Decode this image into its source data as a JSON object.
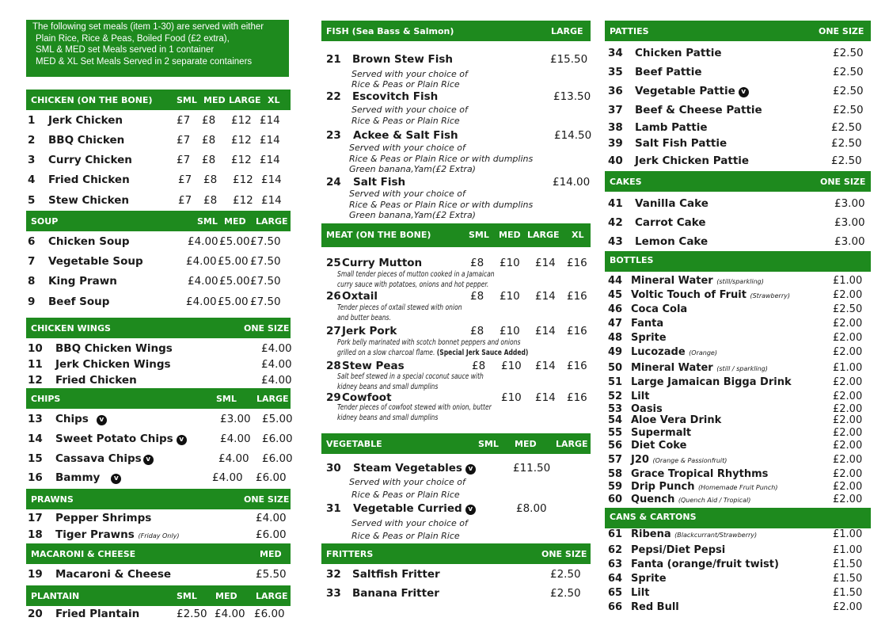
{
  "info_lines": [
    "The following set meals (item 1-30) are served with either",
    "Plain Rice, Rice & Peas, Boiled Food (£2 extra),",
    "SML & MED set Meals served in 1 container",
    "MED & XL Set Meals Served in 2 separate containers"
  ],
  "veg_badge": "v",
  "colors": {
    "header_green": "#1e8a1e"
  },
  "chicken": {
    "title": "CHICKEN (ON THE BONE)",
    "sizes": [
      "SML",
      "MED",
      "LARGE",
      "XL"
    ],
    "items": [
      {
        "num": "1",
        "name": "Jerk Chicken",
        "prices": [
          "£7",
          "£8",
          "£12",
          "£14"
        ]
      },
      {
        "num": "2",
        "name": "BBQ Chicken",
        "prices": [
          "£7",
          "£8",
          "£12",
          "£14"
        ]
      },
      {
        "num": "3",
        "name": "Curry Chicken",
        "prices": [
          "£7",
          "£8",
          "£12",
          "£14"
        ]
      },
      {
        "num": "4",
        "name": "Fried Chicken",
        "prices": [
          "£7",
          "£8",
          "£12",
          "£14"
        ]
      },
      {
        "num": "5",
        "name": "Stew Chicken",
        "prices": [
          "£7",
          "£8",
          "£12",
          "£14"
        ]
      }
    ]
  },
  "soup": {
    "title": "SOUP",
    "sizes": [
      "SML",
      "MED",
      "LARGE"
    ],
    "items": [
      {
        "num": "6",
        "name": "Chicken Soup",
        "prices": [
          "£4.00",
          "£5.00",
          "£7.50"
        ]
      },
      {
        "num": "7",
        "name": "Vegetable Soup",
        "prices": [
          "£4.00",
          "£5.00",
          "£7.50"
        ]
      },
      {
        "num": "8",
        "name": "King Prawn",
        "prices": [
          "£4.00",
          "£5.00",
          "£7.50"
        ]
      },
      {
        "num": "9",
        "name": "Beef Soup",
        "prices": [
          "£4.00",
          "£5.00",
          "£7.50"
        ]
      }
    ]
  },
  "wings": {
    "title": "CHICKEN WINGS",
    "size": "ONE SIZE",
    "items": [
      {
        "num": "10",
        "name": "BBQ Chicken Wings",
        "price": "£4.00"
      },
      {
        "num": "11",
        "name": "Jerk Chicken Wings",
        "price": "£4.00"
      },
      {
        "num": "12",
        "name": "Fried Chicken",
        "price": "£4.00"
      }
    ]
  },
  "chips": {
    "title": "CHIPS",
    "sizes": [
      "SML",
      "LARGE"
    ],
    "items": [
      {
        "num": "13",
        "name": "Chips",
        "prices": [
          "£3.00",
          "£5.00"
        ]
      },
      {
        "num": "14",
        "name": "Sweet Potato Chips",
        "prices": [
          "£4.00",
          "£6.00"
        ]
      },
      {
        "num": "15",
        "name": "Cassava Chips",
        "prices": [
          "£4.00",
          "£6.00"
        ]
      },
      {
        "num": "16",
        "name": "Bammy",
        "prices": [
          "£4.00",
          "£6.00"
        ]
      }
    ]
  },
  "prawns": {
    "title": "PRAWNS",
    "size": "ONE SIZE",
    "items": [
      {
        "num": "17",
        "name": "Pepper Shrimps",
        "price": "£4.00",
        "note": ""
      },
      {
        "num": "18",
        "name": "Tiger Prawns",
        "price": "£6.00",
        "note": "(Friday Only)"
      }
    ]
  },
  "mac": {
    "title": "MACARONI & CHEESE",
    "size": "MED",
    "items": [
      {
        "num": "19",
        "name": "Macaroni & Cheese",
        "price": "£5.50"
      }
    ]
  },
  "plantain": {
    "title": "PLANTAIN",
    "sizes": [
      "SML",
      "MED",
      "LARGE"
    ],
    "items": [
      {
        "num": "20",
        "name": "Fried Plantain",
        "prices": [
          "£2.50",
          "£4.00",
          "£6.00"
        ]
      }
    ]
  },
  "fish": {
    "title": "FISH (Sea Bass & Salmon)",
    "size": "LARGE",
    "items": [
      {
        "num": "21",
        "name": "Brown Stew Fish",
        "price": "£15.50",
        "notes": [
          "Served with your choice of",
          "Rice & Peas or Plain Rice"
        ]
      },
      {
        "num": "22",
        "name": "Escovitch Fish",
        "price": "£13.50",
        "notes": [
          "Served with your choice of",
          "Rice & Peas or Plain Rice"
        ]
      },
      {
        "num": "23",
        "name": "Ackee & Salt Fish",
        "price": "£14.50",
        "notes": [
          "Served with your choice of",
          "Rice & Peas or Plain Rice or with dumplins",
          "Green banana,Yam(£2 Extra)"
        ]
      },
      {
        "num": "24",
        "name": "Salt Fish",
        "price": "£14.00",
        "notes": [
          "Served with your choice of",
          "Rice & Peas or Plain Rice or with dumplins",
          "Green banana,Yam(£2 Extra)"
        ]
      }
    ]
  },
  "meat": {
    "title": "MEAT (ON THE BONE)",
    "sizes": [
      "SML",
      "MED",
      "LARGE",
      "XL"
    ],
    "items": [
      {
        "num": "25",
        "name": "Curry Mutton",
        "prices": [
          "£8",
          "£10",
          "£14",
          "£16"
        ],
        "notes": [
          "Small tender pieces of mutton cooked in a  Jamaican",
          "curry sauce with potatoes, onions and hot pepper."
        ],
        "bold_note": ""
      },
      {
        "num": "26",
        "name": "Oxtail",
        "prices": [
          "£8",
          "£10",
          "£14",
          "£16"
        ],
        "notes": [
          "Tender pieces of oxtail stewed with onion",
          "and butter beans."
        ],
        "bold_note": ""
      },
      {
        "num": "27",
        "name": "Jerk Pork",
        "prices": [
          "£8",
          "£10",
          "£14",
          "£16"
        ],
        "notes": [
          "Pork belly marinated with scotch bonnet peppers and onions",
          "grilled on a slow charcoal flame."
        ],
        "bold_note": "(Special Jerk Sauce Added)"
      },
      {
        "num": "28",
        "name": "Stew Peas",
        "prices": [
          "£8",
          "£10",
          "£14",
          "£16"
        ],
        "notes": [
          "Salt beef stewed in a special coconut sauce with",
          "kidney beans and small dumplins"
        ],
        "bold_note": ""
      },
      {
        "num": "29",
        "name": "Cowfoot",
        "prices": [
          "",
          "£10",
          "£14",
          "£16"
        ],
        "notes": [
          "Tender pieces of cowfoot stewed with onion, butter",
          "kidney beans and small dumplins"
        ],
        "bold_note": ""
      }
    ]
  },
  "veg": {
    "title": "VEGETABLE",
    "sizes": [
      "SML",
      "MED",
      "LARGE"
    ],
    "items": [
      {
        "num": "30",
        "name": "Steam Vegetables",
        "price": "£11.50",
        "notes": [
          "Served with your choice of",
          "Rice & Peas or Plain Rice"
        ]
      },
      {
        "num": "31",
        "name": "Vegetable Curried",
        "price": "£8.00",
        "notes": [
          "Served with your choice of",
          "Rice & Peas or Plain Rice"
        ]
      }
    ]
  },
  "fritters": {
    "title": "FRITTERS",
    "size": "ONE SIZE",
    "items": [
      {
        "num": "32",
        "name": "Saltfish Fritter",
        "price": "£2.50"
      },
      {
        "num": "33",
        "name": "Banana Fritter",
        "price": "£2.50"
      }
    ]
  },
  "patties": {
    "title": "PATTIES",
    "size": "ONE SIZE",
    "items": [
      {
        "num": "34",
        "name": "Chicken Pattie",
        "price": "£2.50"
      },
      {
        "num": "35",
        "name": "Beef Pattie",
        "price": "£2.50"
      },
      {
        "num": "36",
        "name": "Vegetable Pattie",
        "price": "£2.50"
      },
      {
        "num": "37",
        "name": "Beef & Cheese Pattie",
        "price": "£2.50"
      },
      {
        "num": "38",
        "name": "Lamb Pattie",
        "price": "£2.50"
      },
      {
        "num": "39",
        "name": "Salt Fish Pattie",
        "price": "£2.50"
      },
      {
        "num": "40",
        "name": "Jerk Chicken Pattie",
        "price": "£2.50"
      }
    ]
  },
  "cakes": {
    "title": "CAKES",
    "size": "ONE SIZE",
    "items": [
      {
        "num": "41",
        "name": "Vanilla Cake",
        "price": "£3.00"
      },
      {
        "num": "42",
        "name": "Carrot Cake",
        "price": "£3.00"
      },
      {
        "num": "43",
        "name": "Lemon Cake",
        "price": "£3.00"
      }
    ]
  },
  "bottles": {
    "title": "BOTTLES",
    "items": [
      {
        "num": "44",
        "name": "Mineral Water",
        "note": "(still/sparkling)",
        "price": "£1.00"
      },
      {
        "num": "45",
        "name": "Voltic Touch of Fruit",
        "note": "(Strawberry)",
        "price": "£2.00"
      },
      {
        "num": "46",
        "name": "Coca Cola",
        "note": "",
        "price": "£2.50"
      },
      {
        "num": "47",
        "name": "Fanta",
        "note": "",
        "price": "£2.00"
      },
      {
        "num": "48",
        "name": "Sprite",
        "note": "",
        "price": "£2.00"
      },
      {
        "num": "49",
        "name": "Lucozade",
        "note": "(Orange)",
        "price": "£2.00"
      },
      {
        "num": "50",
        "name": "Mineral Water",
        "note": "(still / sparkling)",
        "price": "£1.00"
      },
      {
        "num": "51",
        "name": "Large Jamaican Bigga Drink",
        "note": "",
        "price": "£2.00"
      },
      {
        "num": "52",
        "name": "Lilt",
        "note": "",
        "price": "£2.00"
      },
      {
        "num": "53",
        "name": "Oasis",
        "note": "",
        "price": "£2.00"
      },
      {
        "num": "54",
        "name": "Aloe Vera Drink",
        "note": "",
        "price": "£2.00"
      },
      {
        "num": "55",
        "name": "Supermalt",
        "note": "",
        "price": "£2.00"
      },
      {
        "num": "56",
        "name": "Diet Coke",
        "note": "",
        "price": "£2.00"
      },
      {
        "num": "57",
        "name": "J20",
        "note": "(Orange & Passionfruit)",
        "price": "£2.00"
      },
      {
        "num": "58",
        "name": "Grace Tropical Rhythms",
        "note": "",
        "price": "£2.00"
      },
      {
        "num": "59",
        "name": "Drip Punch",
        "note": "(Homemade Fruit Punch)",
        "price": "£2.00"
      },
      {
        "num": "60",
        "name": "Quench",
        "note": "(Quench Aid / Tropical)",
        "price": "£2.00"
      }
    ]
  },
  "cans": {
    "title": "CANS & CARTONS",
    "items": [
      {
        "num": "61",
        "name": "Ribena",
        "note": "(Blackcurrant/Strawberry)",
        "price": "£1.00"
      },
      {
        "num": "62",
        "name": "Pepsi/Diet Pepsi",
        "note": "",
        "price": "£1.00"
      },
      {
        "num": "63",
        "name": "Fanta (orange/fruit twist)",
        "note": "",
        "price": "£1.50"
      },
      {
        "num": "64",
        "name": "Sprite",
        "note": "",
        "price": "£1.50"
      },
      {
        "num": "65",
        "name": "Lilt",
        "note": "",
        "price": "£1.50"
      },
      {
        "num": "66",
        "name": "Red Bull",
        "note": "",
        "price": "£2.00"
      }
    ]
  }
}
